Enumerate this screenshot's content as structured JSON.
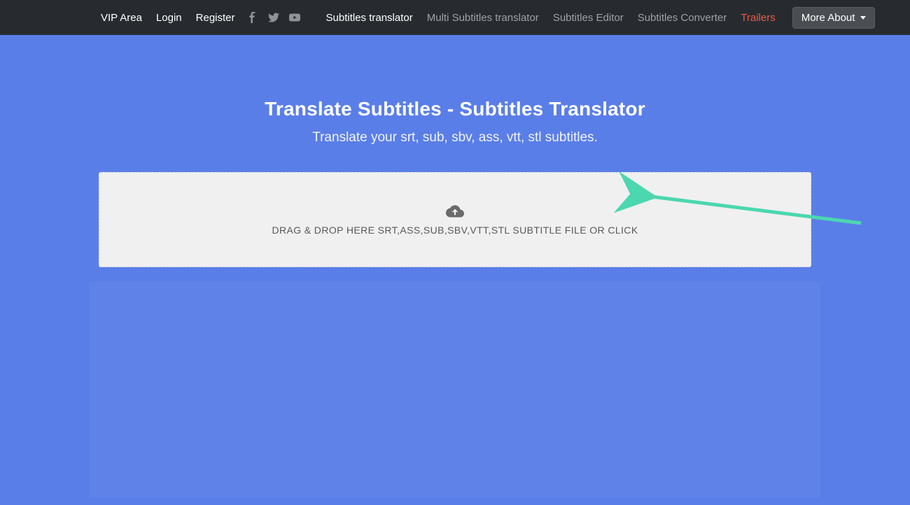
{
  "nav": {
    "vip": "VIP Area",
    "login": "Login",
    "register": "Register",
    "subTranslator": "Subtitles translator",
    "multiSub": "Multi Subtitles translator",
    "editor": "Subtitles Editor",
    "converter": "Subtitles Converter",
    "trailers": "Trailers",
    "moreAbout": "More About"
  },
  "page": {
    "title": "Translate Subtitles - Subtitles Translator",
    "subtitle": "Translate your srt, sub, sbv, ass, vtt, stl subtitles."
  },
  "dropzone": {
    "text": "DRAG & DROP HERE SRT,ASS,SUB,SBV,VTT,STL SUBTITLE FILE OR CLICK"
  },
  "colors": {
    "background": "#5a7ee8",
    "navbar": "#272b30",
    "arrow": "#4bd7af"
  }
}
